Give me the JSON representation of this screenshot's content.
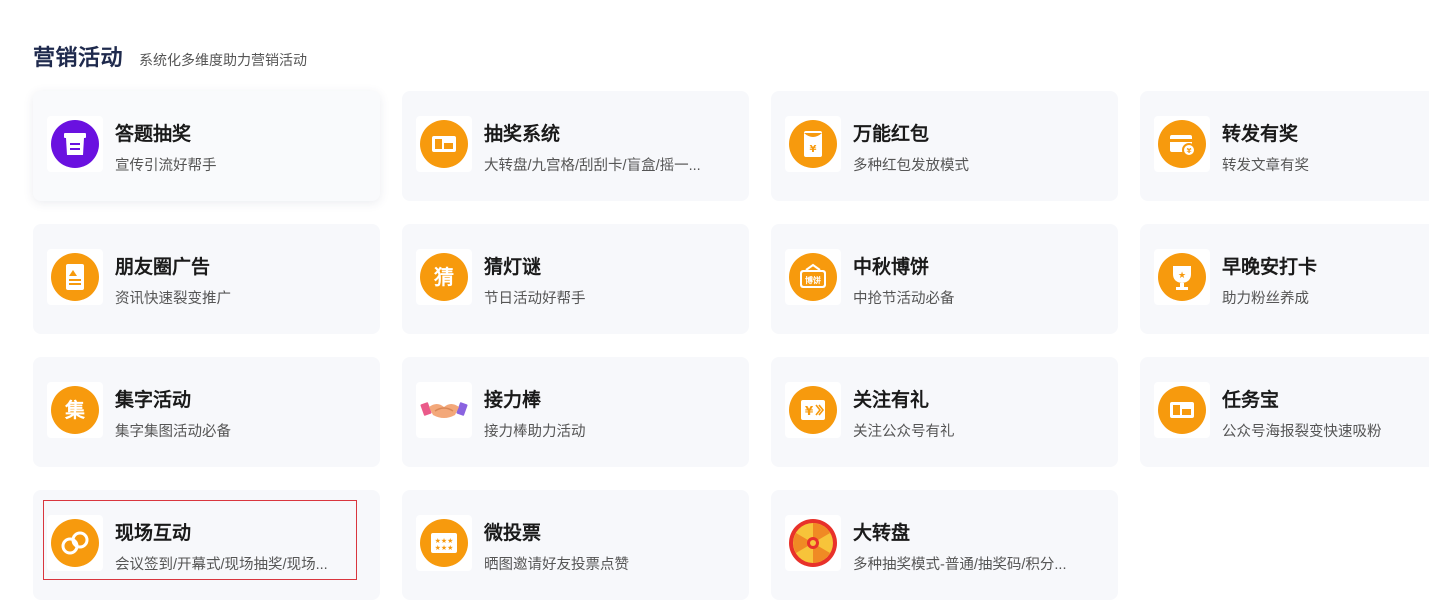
{
  "header": {
    "title": "营销活动",
    "subtitle": "系统化多维度助力营销活动"
  },
  "cards": [
    {
      "name": "答题抽奖",
      "desc": "宣传引流好帮手",
      "icon": "quiz-icon",
      "color": "#6a11e0"
    },
    {
      "name": "抽奖系统",
      "desc": "大转盘/九宫格/刮刮卡/盲盒/摇一...",
      "icon": "ticket-icon",
      "color": "#f79a0d"
    },
    {
      "name": "万能红包",
      "desc": "多种红包发放模式",
      "icon": "red-packet-icon",
      "color": "#f79a0d"
    },
    {
      "name": "转发有奖",
      "desc": "转发文章有奖",
      "icon": "share-reward-icon",
      "color": "#f79a0d"
    },
    {
      "name": "朋友圈广告",
      "desc": "资讯快速裂变推广",
      "icon": "poster-icon",
      "color": "#f79a0d"
    },
    {
      "name": "猜灯谜",
      "desc": "节日活动好帮手",
      "icon": "riddle-icon",
      "color": "#f79a0d",
      "glyph": "猜"
    },
    {
      "name": "中秋博饼",
      "desc": "中抢节活动必备",
      "icon": "mooncake-icon",
      "color": "#f79a0d",
      "glyph": "博饼"
    },
    {
      "name": "早晚安打卡",
      "desc": "助力粉丝养成",
      "icon": "trophy-icon",
      "color": "#f79a0d"
    },
    {
      "name": "集字活动",
      "desc": "集字集图活动必备",
      "icon": "collect-word-icon",
      "color": "#f79a0d",
      "glyph": "集"
    },
    {
      "name": "接力棒",
      "desc": "接力棒助力活动",
      "icon": "handshake-icon",
      "color": "#f79a0d"
    },
    {
      "name": "关注有礼",
      "desc": "关注公众号有礼",
      "icon": "follow-gift-icon",
      "color": "#f79a0d"
    },
    {
      "name": "任务宝",
      "desc": "公众号海报裂变快速吸粉",
      "icon": "task-treasure-icon",
      "color": "#f79a0d"
    },
    {
      "name": "现场互动",
      "desc": "会议签到/开幕式/现场抽奖/现场...",
      "icon": "live-interaction-icon",
      "color": "#f79a0d"
    },
    {
      "name": "微投票",
      "desc": "晒图邀请好友投票点赞",
      "icon": "vote-icon",
      "color": "#f79a0d"
    },
    {
      "name": "大转盘",
      "desc": "多种抽奖模式-普通/抽奖码/积分...",
      "icon": "wheel-icon",
      "color": "#e8312a"
    }
  ],
  "selected_index": 12
}
